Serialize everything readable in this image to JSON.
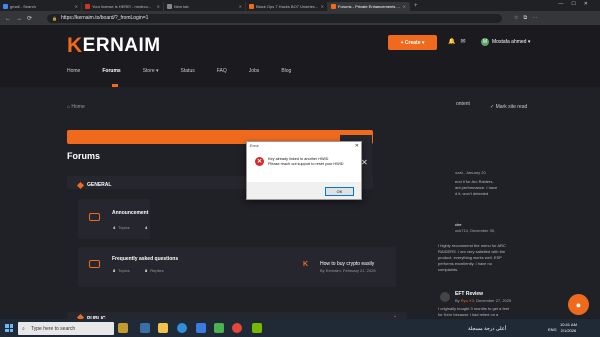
{
  "browser": {
    "tabs": [
      {
        "label": "gmail - Search",
        "color": "#4285f4",
        "active": false
      },
      {
        "label": "Your license is HERE! - mrdeco...",
        "color": "#d93025",
        "active": false
      },
      {
        "label": "New tab",
        "color": "#888888",
        "active": false
      },
      {
        "label": "Black Ops 7 Hacks BO7 Undetec...",
        "color": "#f06a1e",
        "active": false
      },
      {
        "label": "Forums - Private Enhancements ...",
        "color": "#f06a1e",
        "active": true
      },
      {
        "label": "+",
        "color": "",
        "active": false
      }
    ],
    "url": "https://kernaim.to/board/?_fromLogin=1"
  },
  "site": {
    "logo_text": "KERNAIM",
    "logo_k": "K",
    "new_button": "+ Create ▾",
    "user_name": "Mostafa ahmed ▾",
    "user_initial": "M",
    "nav": [
      "Home",
      "Forums",
      "Store ▾",
      "Status",
      "FAQ",
      "Jobs",
      "Blog"
    ],
    "nav_current": "Forums"
  },
  "page": {
    "breadcrumb": "⌂ Home",
    "title": "Forums",
    "sections": {
      "general": "GENERAL",
      "public": "PUBLIC"
    },
    "forums": [
      {
        "title": "Announcement",
        "topics_count": "4",
        "topics_label": "Topics",
        "replies_count": "4"
      },
      {
        "title": "Frequently asked questions",
        "topics_count": "8",
        "topics_label": "Topics",
        "replies_count": "8",
        "replies_label": "Replies"
      }
    ],
    "latest_post": {
      "title": "How to buy crypto easily",
      "meta": "By Kernaim, February 21, 2025"
    }
  },
  "right_column": {
    "top_partial": "ontent",
    "mark_read": "✓ Mark site read",
    "snippets": [
      "ozaL, January 20",
      "end it for Arc Raiders,",
      "ant performance. I have",
      "d it, won't detected",
      "che",
      "ock714, December 30,",
      "I highly recommend the menu for ARC",
      "RAIDERS. I am very satisfied with the",
      "product, everything works well. ESP",
      "performs excellently. I have no",
      "complaints.",
      "EFT Review",
      "By",
      "Ryu X3",
      ", December 27, 2025",
      "I originally bought 3 months to get a feel",
      "for Kern because I had relied on a",
      "...previous cheat..."
    ]
  },
  "dialog": {
    "title": "Error",
    "close": "✕",
    "message_line1": "Key already linked to another HWID",
    "message_line2": "Please reach out support to reset your HWID",
    "ok_label": "OK",
    "modal_close": "✕"
  },
  "taskbar": {
    "search_placeholder": "Type here to search",
    "tray_text": "ESP",
    "arabic_text": "أعلى درجة مسجلة",
    "language": "ENG",
    "time": "10:41 AM",
    "date": "2/1/2026"
  }
}
